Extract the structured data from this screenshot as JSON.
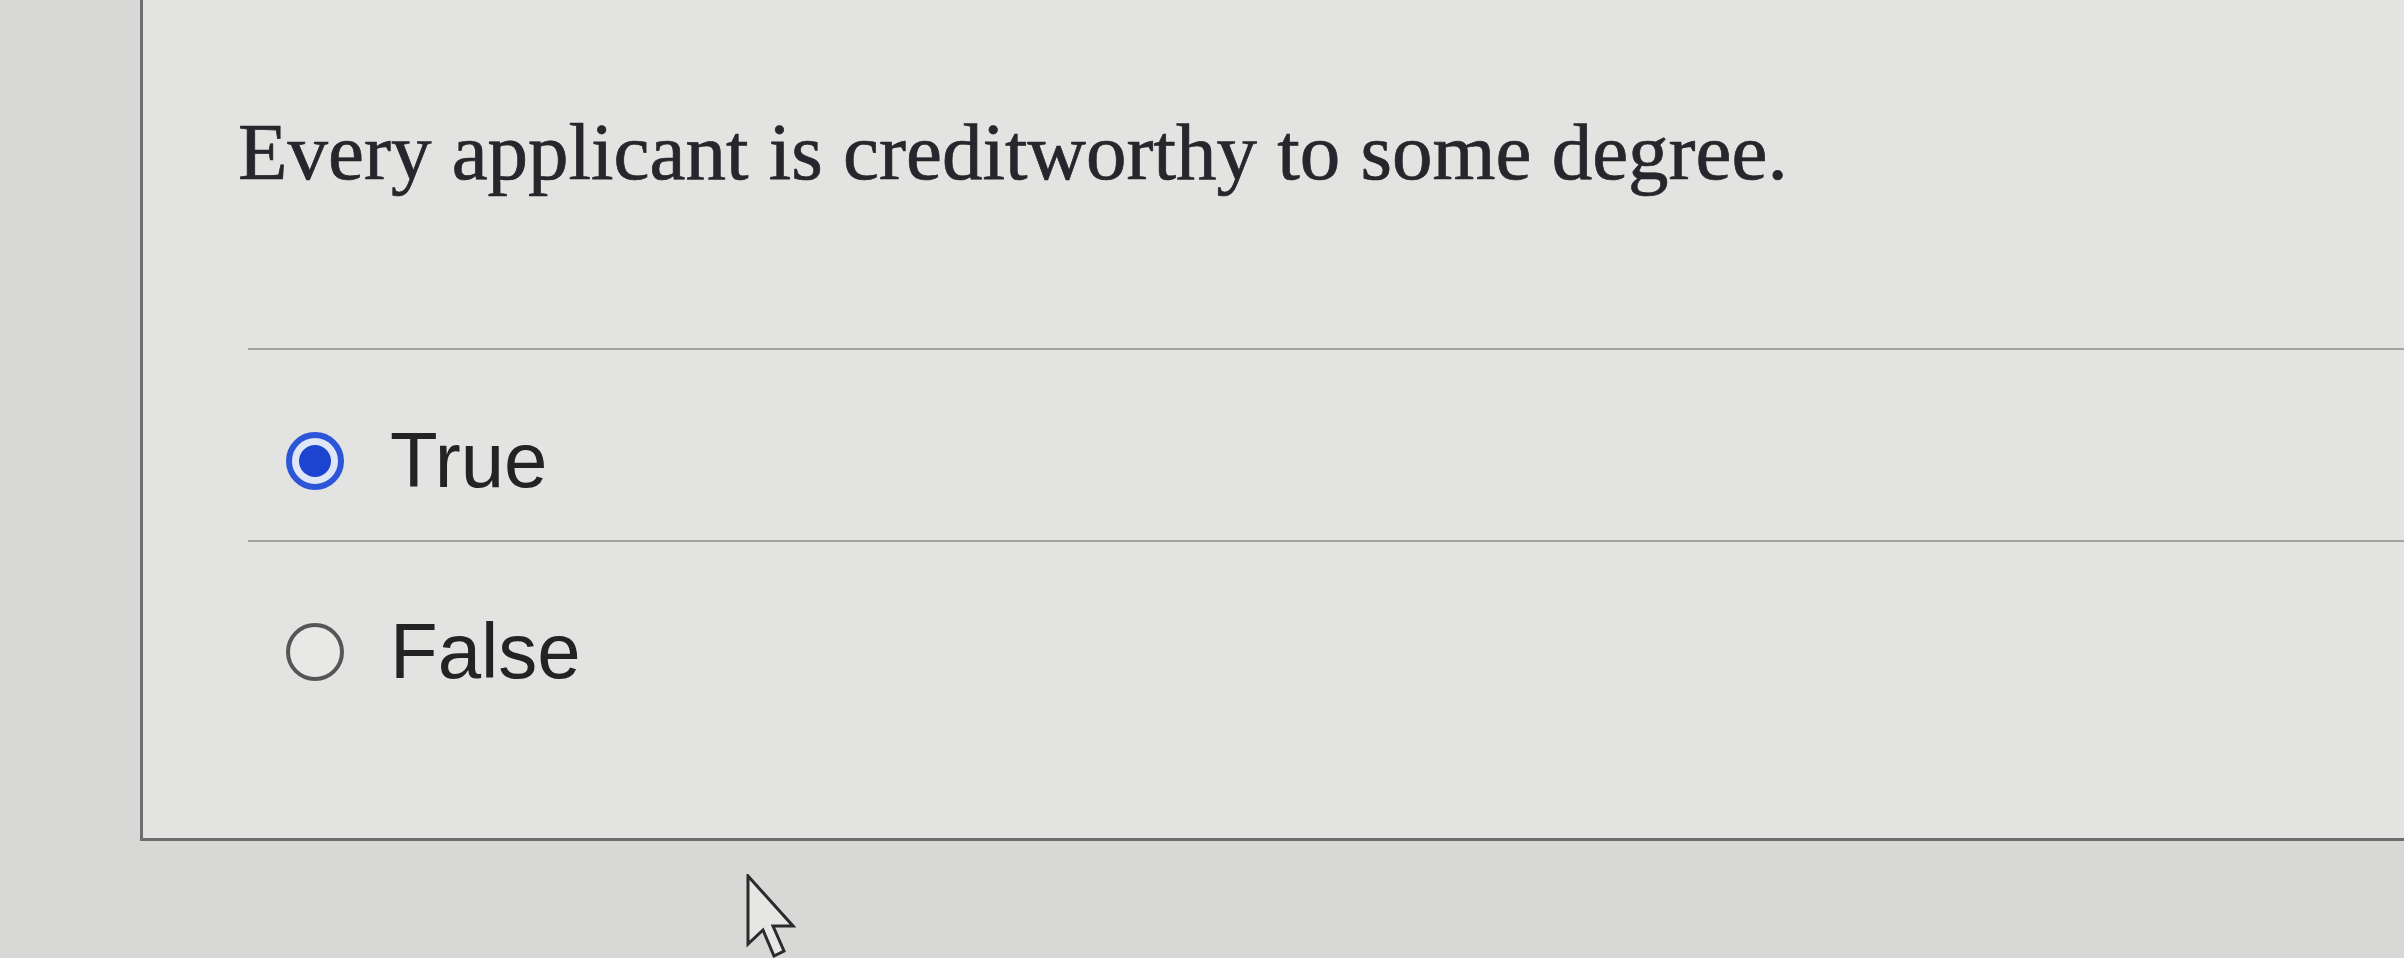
{
  "question": {
    "text": "Every applicant is creditworthy to some degree."
  },
  "options": [
    {
      "label": "True",
      "selected": true
    },
    {
      "label": "False",
      "selected": false
    }
  ]
}
